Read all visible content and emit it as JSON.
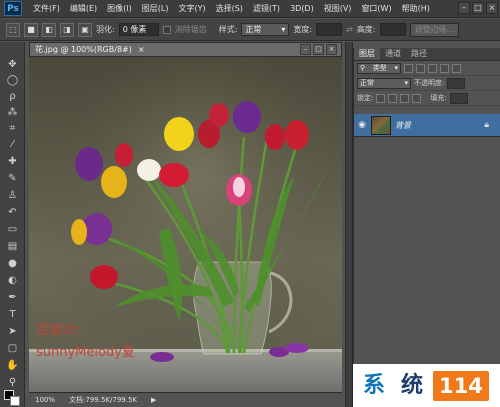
{
  "app": {
    "logo": "Ps"
  },
  "menu": [
    "文件(F)",
    "编辑(E)",
    "图像(I)",
    "图层(L)",
    "文字(Y)",
    "选择(S)",
    "滤镜(T)",
    "3D(D)",
    "视图(V)",
    "窗口(W)",
    "帮助(H)"
  ],
  "options": {
    "feather_label": "羽化:",
    "feather_value": "0 像素",
    "antialias_label": "消除锯齿",
    "style_label": "样式:",
    "style_value": "正常",
    "width_label": "宽度:",
    "height_label": "高度:",
    "refine_button": "调整边缘..."
  },
  "document": {
    "tab_title": "花.jpg @ 100%(RGB/8#)",
    "close": "×",
    "zoom": "100%",
    "doc_info": "文档:799.5K/799.5K"
  },
  "watermark": {
    "line1": "百度ID:",
    "line2": "sunnyMelody夏"
  },
  "layers": {
    "tabs": [
      "图层",
      "通道",
      "路径"
    ],
    "kind_label": "类型",
    "blend_mode": "正常",
    "opacity_label": "不透明度:",
    "lock_label": "锁定:",
    "fill_label": "填充:",
    "layer_name": "背景"
  },
  "badge": {
    "char1": "系",
    "char2": "统",
    "number": "114"
  },
  "colors": {
    "accent_layer": "#3f6e9f",
    "badge_orange": "#f07a1a",
    "badge_blue": "#0f73b8"
  },
  "icons": [
    "ps-logo-icon",
    "rect-marquee-icon",
    "eye-icon",
    "lock-icon"
  ]
}
